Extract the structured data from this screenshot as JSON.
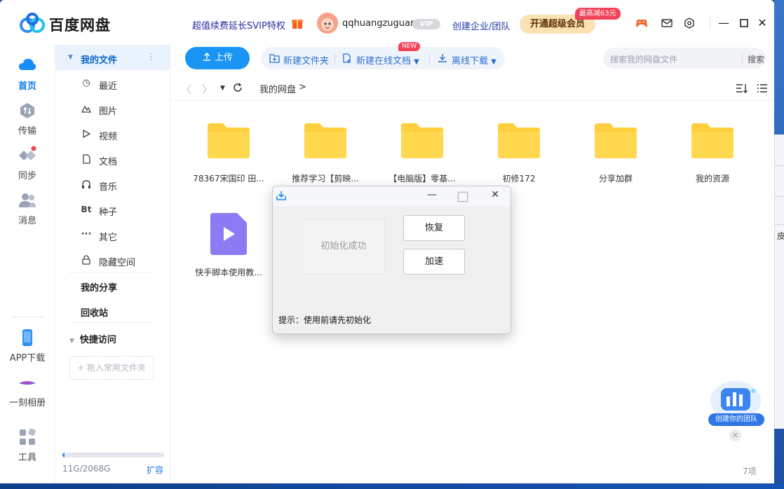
{
  "app": {
    "name": "百度网盘",
    "promo": "超值续费延长SVIP特权",
    "username": "qqhuangzuguan",
    "vip_label": "VIP",
    "enterprise_link": "创建企业/团队",
    "super_member_button": "开通超级会员",
    "discount_badge": "最高减63元",
    "brand_color": "#1a95f4"
  },
  "left_nav": {
    "items": [
      {
        "label": "首页",
        "icon": "cloud-home-icon",
        "active": true
      },
      {
        "label": "传输",
        "icon": "transfer-icon"
      },
      {
        "label": "同步",
        "icon": "sync-icon"
      },
      {
        "label": "消息",
        "icon": "message-icon"
      }
    ],
    "bottom": [
      {
        "label": "APP下载",
        "icon": "phone-icon"
      },
      {
        "label": "一刻相册",
        "icon": "album-icon"
      },
      {
        "label": "工具",
        "icon": "tools-icon"
      }
    ]
  },
  "side_menu": {
    "my_files": "我的文件",
    "items": [
      {
        "label": "最近",
        "icon": "clock-icon"
      },
      {
        "label": "图片",
        "icon": "image-icon"
      },
      {
        "label": "视频",
        "icon": "play-icon"
      },
      {
        "label": "文档",
        "icon": "document-icon"
      },
      {
        "label": "音乐",
        "icon": "headphone-icon"
      },
      {
        "label": "种子",
        "icon": "bt-icon",
        "glyph": "Bt"
      },
      {
        "label": "其它",
        "icon": "more-icon",
        "glyph": "···"
      },
      {
        "label": "隐藏空间",
        "icon": "lock-icon"
      }
    ],
    "my_share": "我的分享",
    "recycle": "回收站",
    "quick_access": "快捷访问",
    "drop_hint": "+ 拖入常用文件夹",
    "storage": "11G/2068G",
    "storage_used_fraction": 0.0053,
    "expand": "扩容"
  },
  "toolbar": {
    "upload": "上传",
    "new_folder": "新建文件夹",
    "new_online_doc": "新建在线文档",
    "new_tag": "NEW",
    "offline_download": "离线下载",
    "search_placeholder": "搜索我的网盘文件",
    "search_button": "搜索"
  },
  "breadcrumb": {
    "root": "我的网盘",
    "separator": ">"
  },
  "files": [
    {
      "name": "78367宋国印 田...",
      "type": "folder"
    },
    {
      "name": "推荐学习【剪映...",
      "type": "folder"
    },
    {
      "name": "【电脑版】零基...",
      "type": "folder"
    },
    {
      "name": "初修172",
      "type": "folder"
    },
    {
      "name": "分享加群",
      "type": "folder"
    },
    {
      "name": "我的资源",
      "type": "folder"
    },
    {
      "name": "快手脚本使用教...",
      "type": "video"
    }
  ],
  "item_count": "7项",
  "dialog": {
    "status": "初始化成功",
    "restore_button": "恢复",
    "speedup_button": "加速",
    "hint": "提示：使用前请先初始化"
  },
  "team_badge": {
    "label": "创建你的团队"
  },
  "background_window": {
    "fragment": "皮"
  }
}
